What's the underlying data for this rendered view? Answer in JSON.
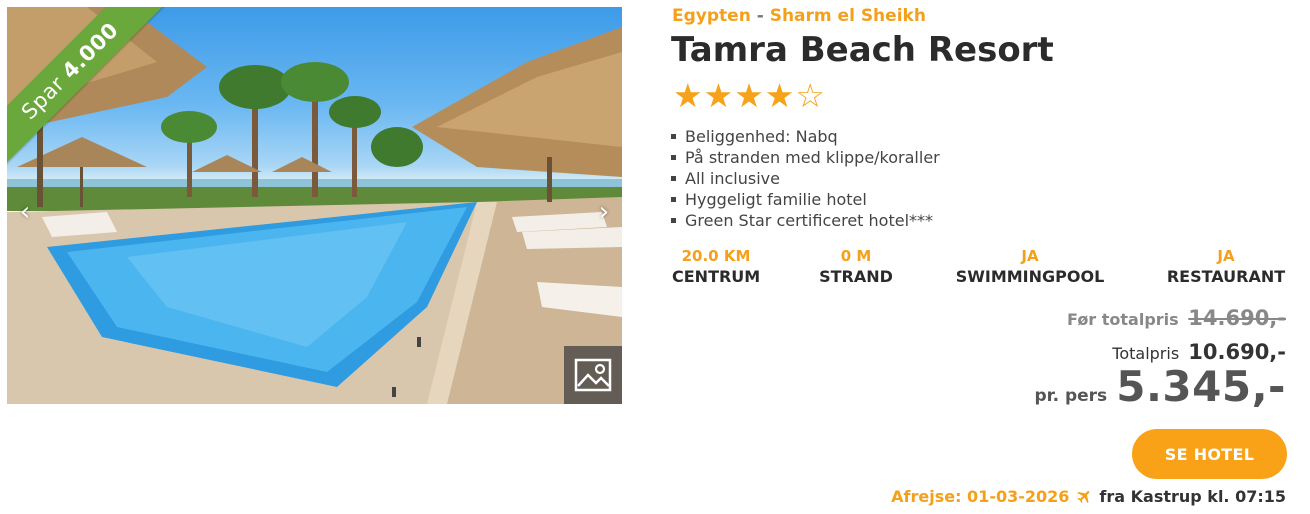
{
  "image": {
    "badge_prefix": "Spar",
    "badge_amount": "4.000",
    "prev_icon": "chevron-left-icon",
    "next_icon": "chevron-right-icon",
    "gallery_icon": "image-gallery-icon"
  },
  "location": {
    "country": "Egypten",
    "separator": "-",
    "city": "Sharm el Sheikh"
  },
  "hotel": {
    "name": "Tamra Beach Resort",
    "rating": 4,
    "max_rating": 5
  },
  "features": [
    "Beliggenhed: Nabq",
    "På stranden med klippe/koraller",
    "All inclusive",
    "Hyggeligt familie hotel",
    "Green Star certificeret hotel***"
  ],
  "facts": [
    {
      "value": "20.0 KM",
      "label": "CENTRUM"
    },
    {
      "value": "0 M",
      "label": "STRAND"
    },
    {
      "value": "JA",
      "label": "SWIMMINGPOOL"
    },
    {
      "value": "JA",
      "label": "RESTAURANT"
    }
  ],
  "pricing": {
    "before_label": "Før totalpris",
    "before_amount": "14.690,-",
    "total_label": "Totalpris",
    "total_amount": "10.690,-",
    "per_person_label": "pr. pers",
    "per_person_amount": "5.345,-"
  },
  "cta": {
    "label": "SE HOTEL"
  },
  "departure": {
    "date_text": "Afrejse: 01-03-2026",
    "icon": "airplane-icon",
    "from_text": "fra Kastrup kl. 07:15"
  },
  "colors": {
    "accent": "#f5a01a",
    "badge_green": "#6aa83b",
    "cta": "#f9a117"
  }
}
